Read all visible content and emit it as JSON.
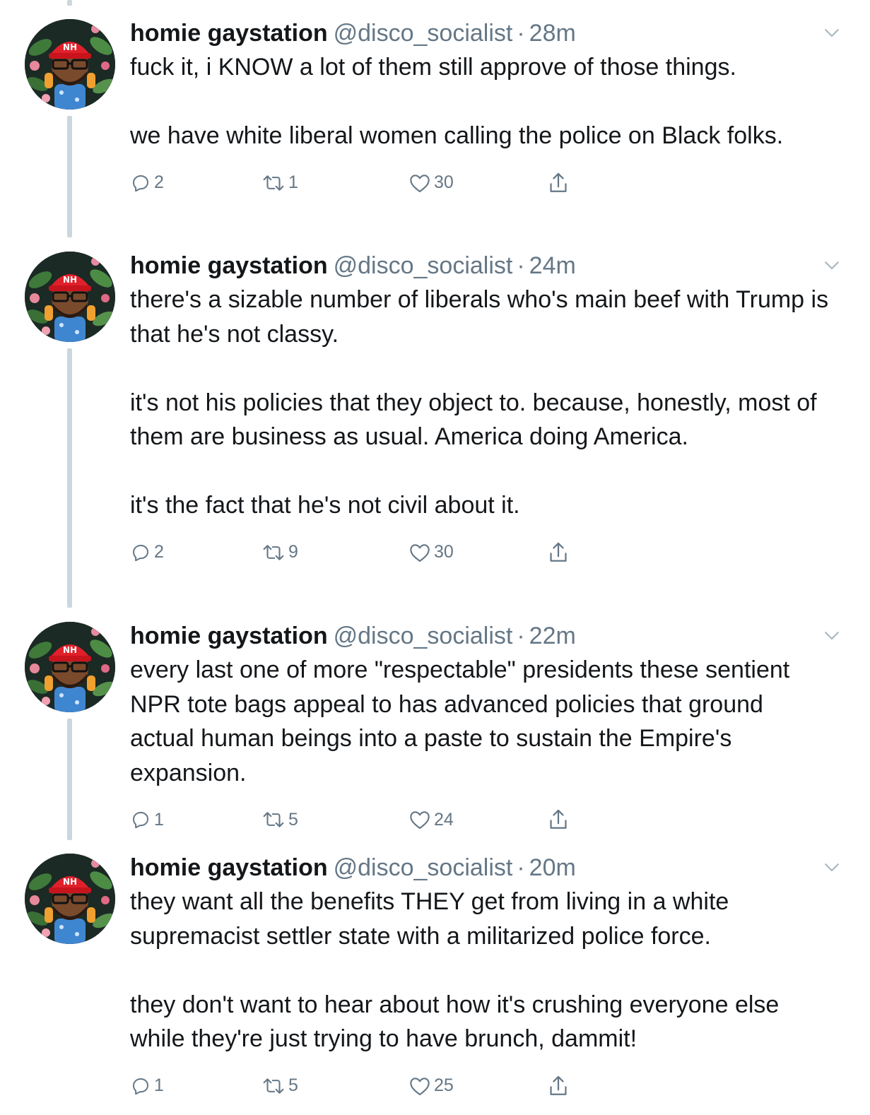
{
  "tweets": [
    {
      "name": "homie gaystation",
      "handle": "@disco_socialist",
      "separator": "·",
      "time": "28m",
      "text": "fuck it, i KNOW a lot of them still approve of those things.\n\nwe have white liberal women calling the police on Black folks.",
      "replies": "2",
      "retweets": "1",
      "likes": "30"
    },
    {
      "name": "homie gaystation",
      "handle": "@disco_socialist",
      "separator": "·",
      "time": "24m",
      "text": "there's a sizable number of liberals who's main beef with Trump is that he's not classy.\n\nit's not his policies that they object to. because, honestly, most of them are business as usual. America doing America.\n\nit's the fact that he's not civil about it.",
      "replies": "2",
      "retweets": "9",
      "likes": "30"
    },
    {
      "name": "homie gaystation",
      "handle": "@disco_socialist",
      "separator": "·",
      "time": "22m",
      "text": "every last one of more \"respectable\" presidents these sentient NPR tote bags appeal to has advanced policies that ground actual human beings into a paste to sustain the Empire's expansion.",
      "replies": "1",
      "retweets": "5",
      "likes": "24"
    },
    {
      "name": "homie gaystation",
      "handle": "@disco_socialist",
      "separator": "·",
      "time": "20m",
      "text": "they want all the benefits THEY get from living in a white supremacist settler state with a militarized police force.\n\nthey don't want to hear about how it's crushing everyone else while they're just trying to have brunch, dammit!",
      "replies": "1",
      "retweets": "5",
      "likes": "25"
    }
  ],
  "icons": {
    "reply": "reply-icon",
    "retweet": "retweet-icon",
    "like": "heart-icon",
    "share": "share-icon",
    "more": "chevron-down-icon",
    "avatar_hat_text": "NH"
  },
  "colors": {
    "text": "#14171a",
    "secondary": "#657786",
    "thread_line": "#ccd6dd",
    "hat_red": "#e0202a"
  }
}
